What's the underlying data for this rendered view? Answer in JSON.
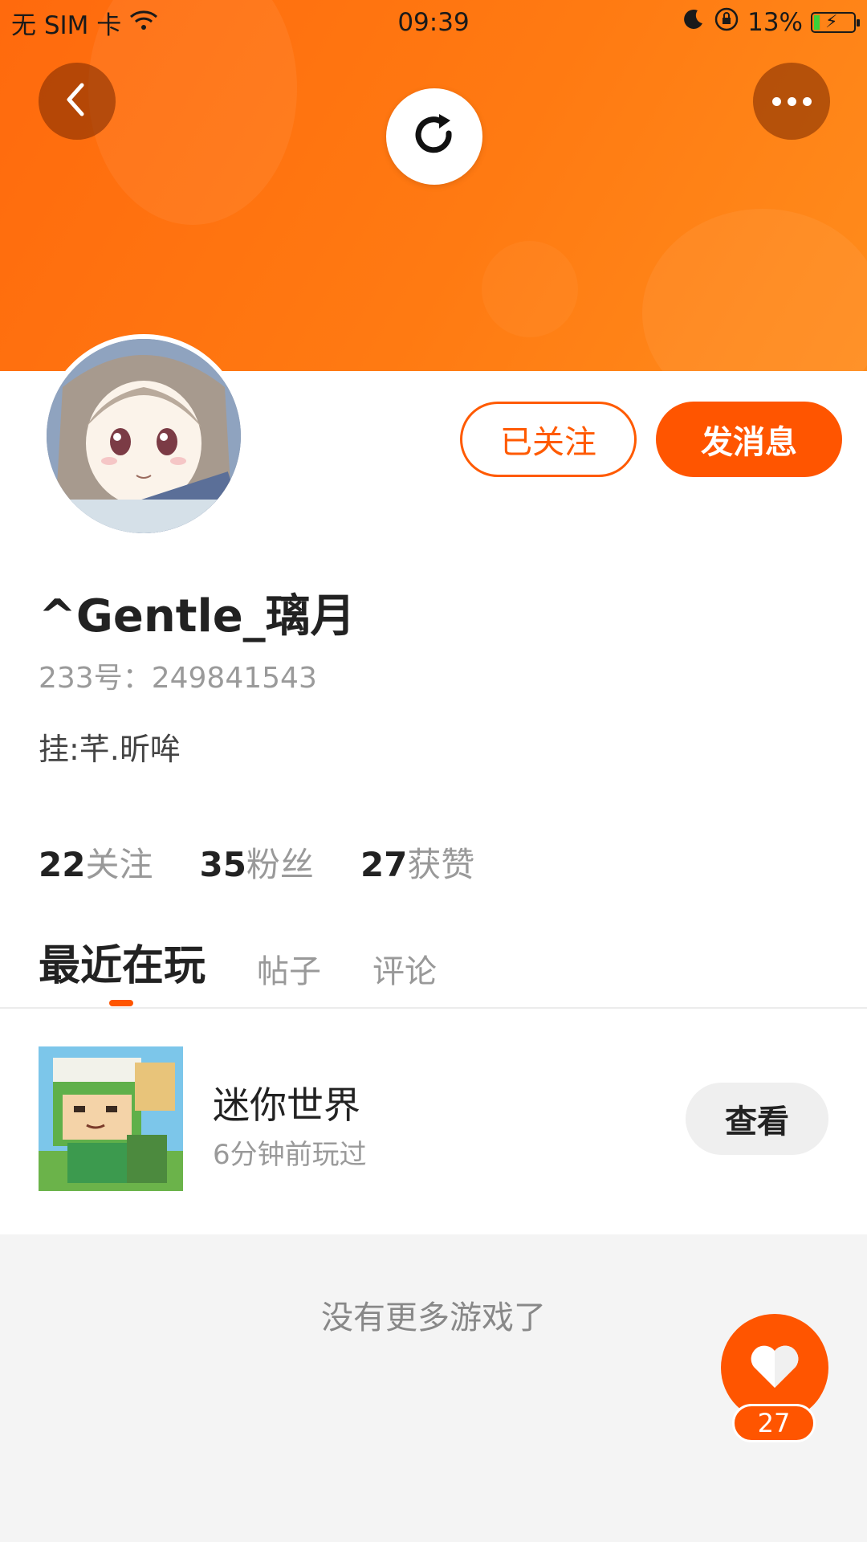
{
  "status_bar": {
    "carrier": "无 SIM 卡",
    "time": "09:39",
    "battery": "13%"
  },
  "header": {
    "back_icon": "chevron-left-icon",
    "refresh_icon": "refresh-icon",
    "more_icon": "more-dots-icon"
  },
  "profile": {
    "username": "^Gentle_璃月",
    "id_label": "233号：249841543",
    "bio": "挂:芊.昕哞",
    "follow_button": "已关注",
    "message_button": "发消息"
  },
  "stats": [
    {
      "num": "22",
      "label": "关注"
    },
    {
      "num": "35",
      "label": "粉丝"
    },
    {
      "num": "27",
      "label": "获赞"
    }
  ],
  "tabs": [
    {
      "label": "最近在玩",
      "active": true
    },
    {
      "label": "帖子",
      "active": false
    },
    {
      "label": "评论",
      "active": false
    }
  ],
  "games": [
    {
      "name": "迷你世界",
      "played": "6分钟前玩过",
      "action": "查看"
    }
  ],
  "footer": {
    "no_more": "没有更多游戏了",
    "like_count": "27"
  },
  "colors": {
    "accent": "#ff5500",
    "hero": "#ff7a12"
  }
}
